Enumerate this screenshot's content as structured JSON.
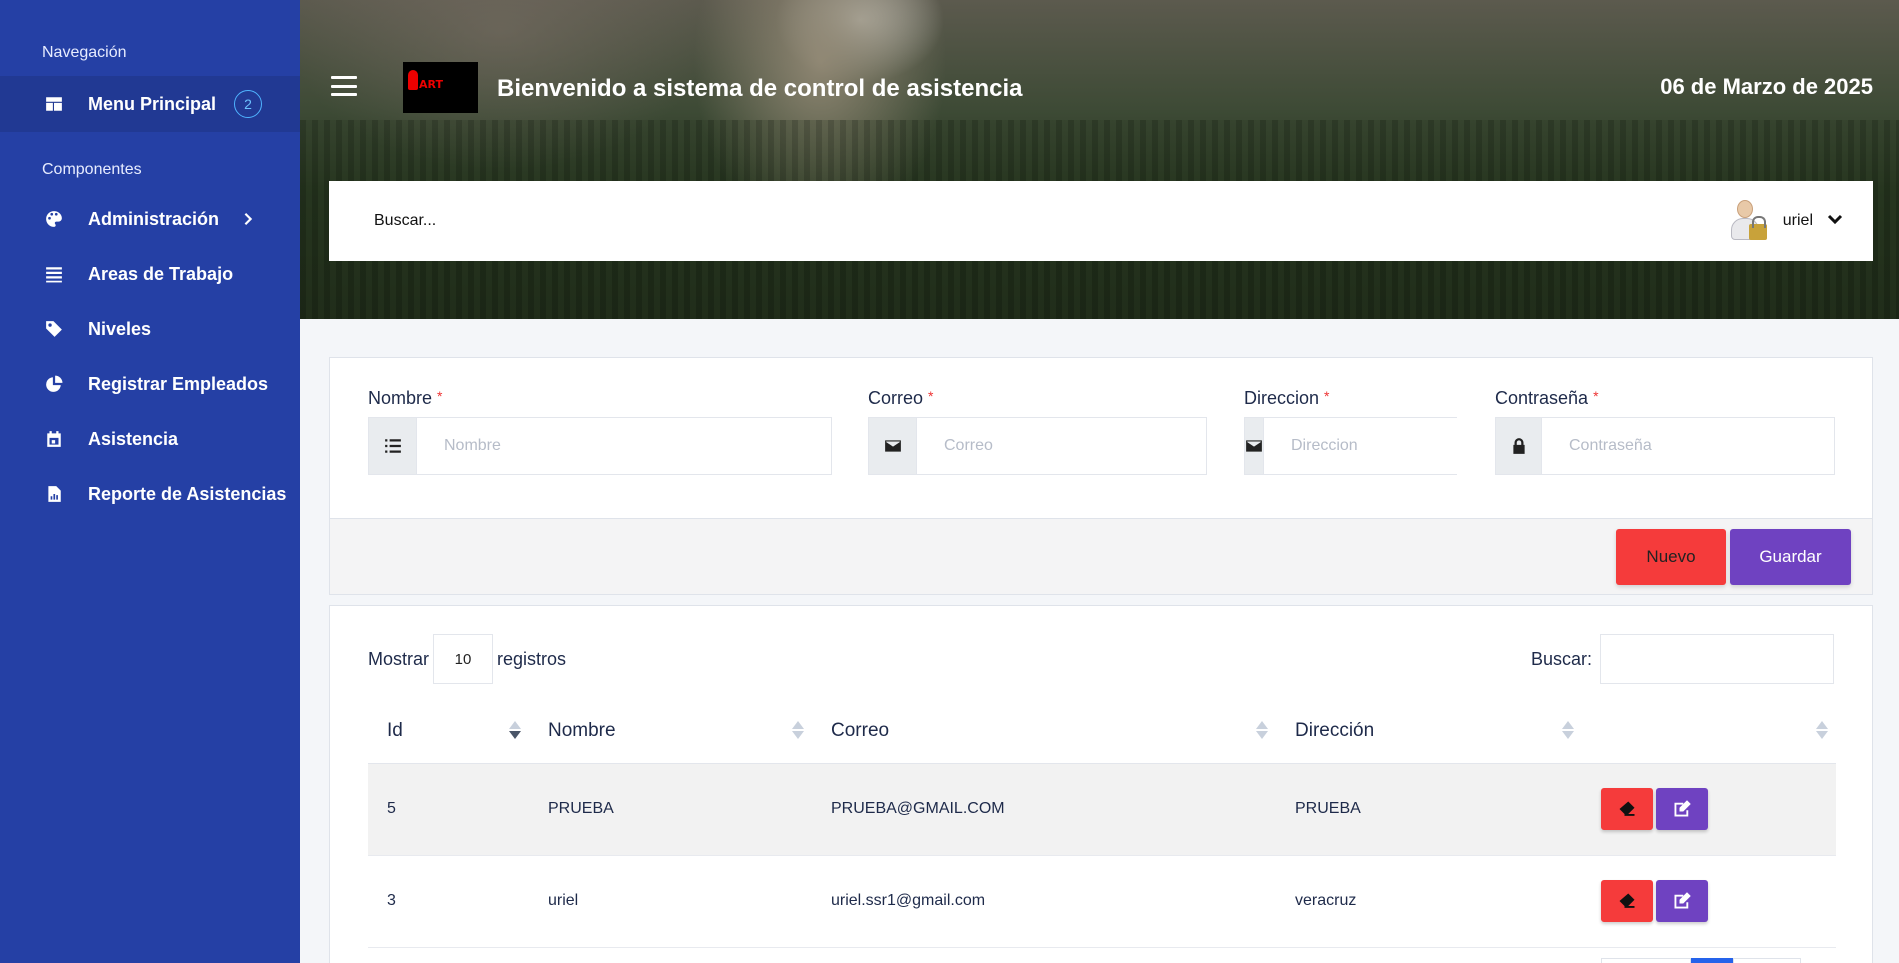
{
  "sidebar": {
    "nav_label": "Navegación",
    "menu_principal": "Menu Principal",
    "menu_badge": "2",
    "components_label": "Componentes",
    "items": [
      {
        "label": "Administración",
        "icon": "palette-icon"
      },
      {
        "label": "Areas de Trabajo",
        "icon": "list-icon"
      },
      {
        "label": "Niveles",
        "icon": "tag-icon"
      },
      {
        "label": "Registrar Empleados",
        "icon": "pie-chart-icon"
      },
      {
        "label": "Asistencia",
        "icon": "calendar-icon"
      },
      {
        "label": "Reporte de Asistencias",
        "icon": "report-icon"
      }
    ]
  },
  "header": {
    "logo_text": "ART",
    "title": "Bienvenido a sistema de control de asistencia",
    "date": "06 de Marzo de 2025"
  },
  "topbar": {
    "search_placeholder": "Buscar...",
    "username": "uriel"
  },
  "form": {
    "fields": [
      {
        "label": "Nombre",
        "placeholder": "Nombre",
        "icon": "list-icon"
      },
      {
        "label": "Correo",
        "placeholder": "Correo",
        "icon": "envelope-icon"
      },
      {
        "label": "Direccion",
        "placeholder": "Direccion",
        "icon": "envelope-icon"
      },
      {
        "label": "Contraseña",
        "placeholder": "Contraseña",
        "icon": "lock-icon"
      }
    ],
    "required_mark": "*",
    "nuevo_label": "Nuevo",
    "guardar_label": "Guardar"
  },
  "table": {
    "show_label": "Mostrar",
    "page_length": "10",
    "records_label": "registros",
    "search_label": "Buscar:",
    "columns": [
      "Id",
      "Nombre",
      "Correo",
      "Dirección",
      ""
    ],
    "rows": [
      {
        "id": "5",
        "nombre": "PRUEBA",
        "correo": "PRUEBA@GMAIL.COM",
        "direccion": "PRUEBA"
      },
      {
        "id": "3",
        "nombre": "uriel",
        "correo": "uriel.ssr1@gmail.com",
        "direccion": "veracruz"
      }
    ]
  },
  "colors": {
    "sidebar": "#2540a5",
    "danger": "#f53b3b",
    "primary": "#6f42c1"
  }
}
